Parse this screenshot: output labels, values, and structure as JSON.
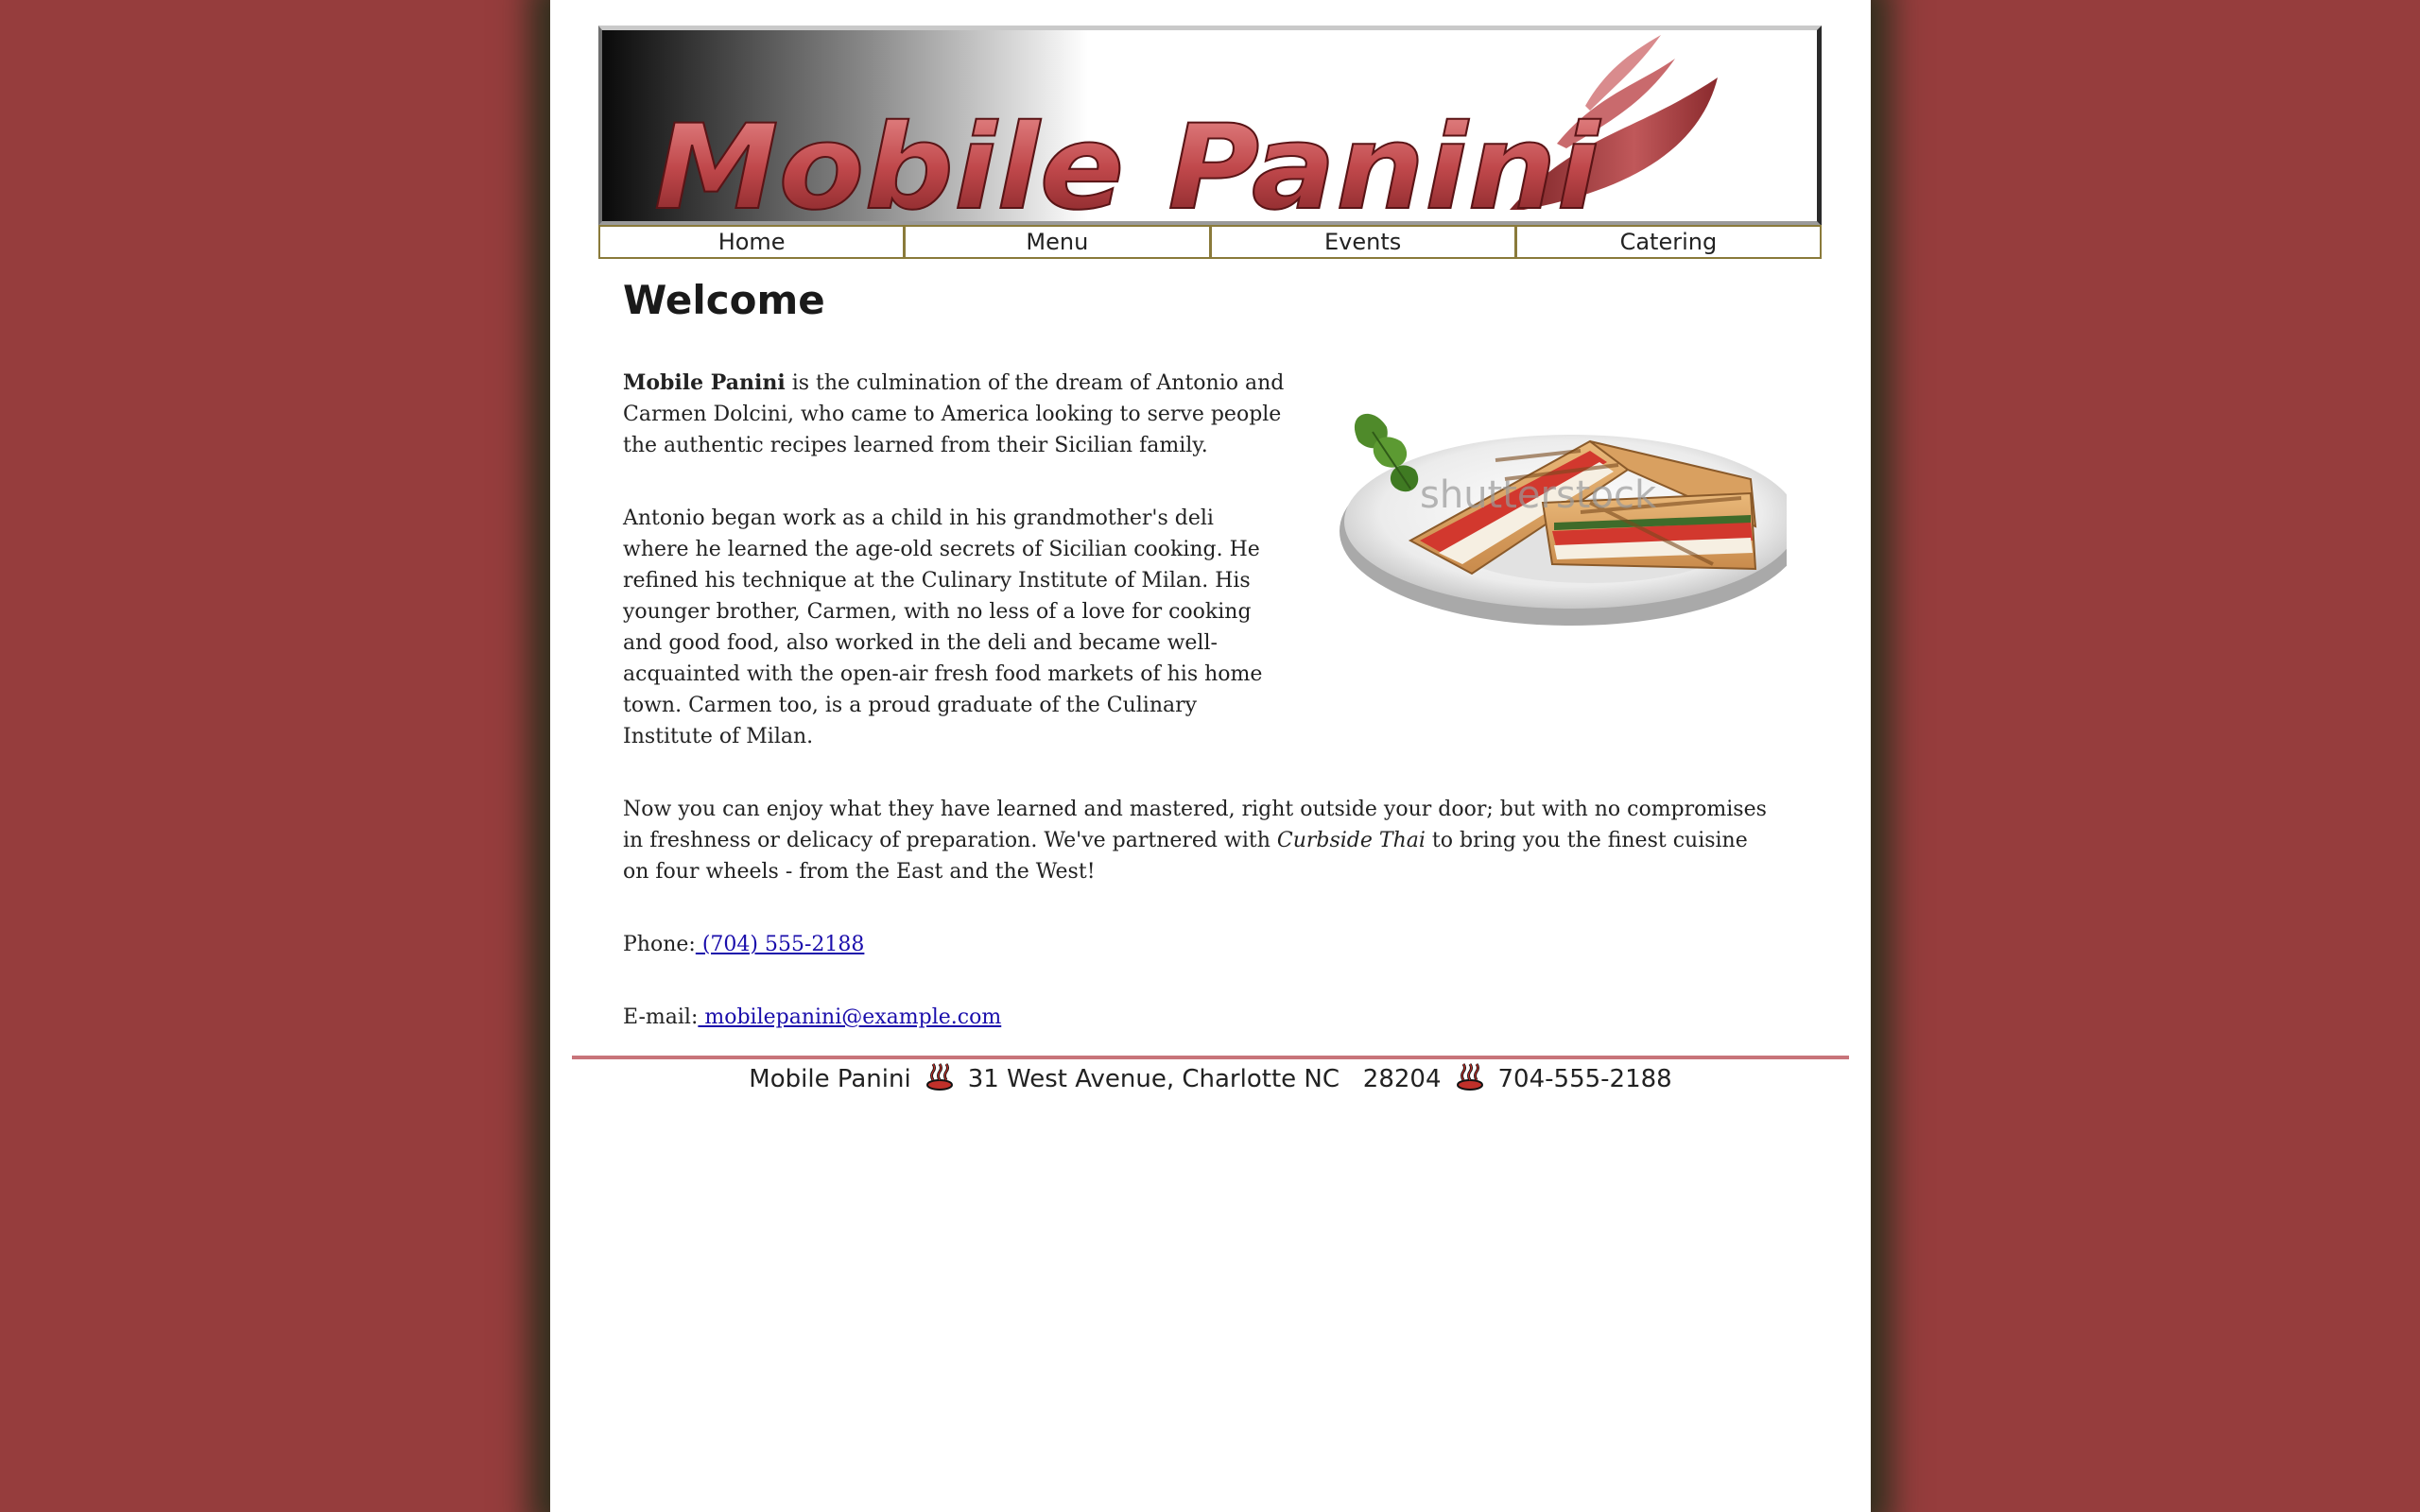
{
  "banner": {
    "title": "Mobile Panini"
  },
  "nav": {
    "items": [
      {
        "label": "Home"
      },
      {
        "label": "Menu"
      },
      {
        "label": "Events"
      },
      {
        "label": "Catering"
      }
    ]
  },
  "main": {
    "heading": "Welcome",
    "p1_bold": "Mobile Panini",
    "p1_rest": " is the culmination of the dream of Antonio and Carmen Dolcini, who came to America looking to serve people the authentic recipes learned from their Sicilian family.",
    "p2": "Antonio began work as a child in his grandmother's deli where he learned the age-old secrets of Sicilian cooking. He refined his technique at the Culinary Institute of Milan. His younger brother, Carmen, with no less of a love for cooking and good food, also worked in the deli and became well-acquainted with the open-air fresh food markets of his home town. Carmen too, is a proud graduate of the Culinary Institute of Milan.",
    "p3_start": "Now you can enjoy what they have learned and mastered, right outside your door; but with no compromises in freshness or delicacy of preparation. We've partnered with ",
    "p3_italic": "Curbside Thai",
    "p3_end": " to bring you the finest cuisine on four wheels - from the East and the West!",
    "phone_label": "Phone:",
    "phone_link": " (704) 555-2188",
    "email_label": "E-mail:",
    "email_link": " mobilepanini@example.com",
    "photo_watermark": "shutterstock"
  },
  "footer": {
    "name": "Mobile Panini",
    "address": "31 West Avenue, Charlotte NC   28204",
    "phone": "704-555-2188"
  },
  "colors": {
    "background": "#963d3d",
    "accent": "#c8747a",
    "nav_border": "#8a7a3a",
    "link": "#1a0dab"
  }
}
